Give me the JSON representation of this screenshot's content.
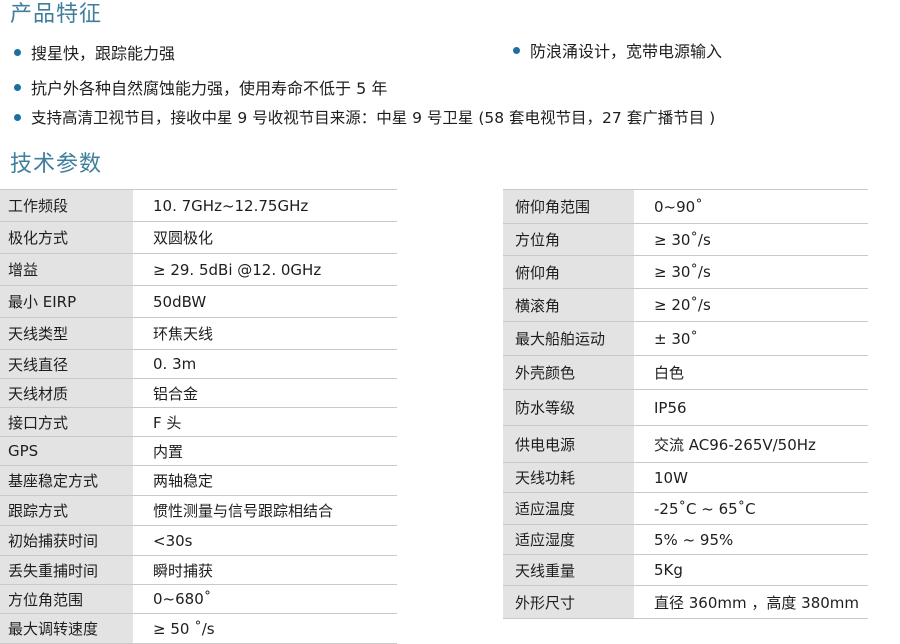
{
  "features_title": "产品特征",
  "specs_title": "技术参数",
  "features": [
    "搜星快，跟踪能力强",
    "防浪涌设计，宽带电源输入",
    "抗户外各种自然腐蚀能力强，使用寿命不低于 5 年",
    "支持高清卫视节目，接收中星 9 号收视节目来源：中星 9 号卫星 (58 套电视节目，27 套广播节目 )"
  ],
  "left_table": [
    {
      "label": "工作频段",
      "value": "10. 7GHz~12.75GHz"
    },
    {
      "label": "极化方式",
      "value": "双圆极化"
    },
    {
      "label": "增益",
      "value": "≥ 29. 5dBi  @12. 0GHz"
    },
    {
      "label": "最小 EIRP",
      "value": "50dBW"
    },
    {
      "label": "天线类型",
      "value": "环焦天线"
    },
    {
      "label": "天线直径",
      "value": "0. 3m"
    },
    {
      "label": "天线材质",
      "value": "铝合金"
    },
    {
      "label": "接口方式",
      "value": "F 头"
    },
    {
      "label": "GPS",
      "value": "内置"
    },
    {
      "label": "基座稳定方式",
      "value": "两轴稳定"
    },
    {
      "label": "跟踪方式",
      "value": "惯性测量与信号跟踪相结合"
    },
    {
      "label": "初始捕获时间",
      "value": "<30s"
    },
    {
      "label": "丢失重捕时间",
      "value": "瞬时捕获"
    },
    {
      "label": "方位角范围",
      "value": "0~680˚"
    },
    {
      "label": "最大调转速度",
      "value": "≥ 50 ˚/s"
    }
  ],
  "right_table": [
    {
      "label": "俯仰角范围",
      "value": "0~90˚"
    },
    {
      "label": "方位角",
      "value": "≥ 30˚/s"
    },
    {
      "label": "俯仰角",
      "value": "≥ 30˚/s"
    },
    {
      "label": "横滚角",
      "value": "≥ 20˚/s"
    },
    {
      "label": "最大船舶运动",
      "value": "± 30˚"
    },
    {
      "label": "外壳颜色",
      "value": "白色"
    },
    {
      "label": "防水等级",
      "value": "IP56"
    },
    {
      "label": "供电电源",
      "value": "交流 AC96-265V/50Hz"
    },
    {
      "label": "天线功耗",
      "value": "10W"
    },
    {
      "label": "适应温度",
      "value": "-25˚C ~ 65˚C"
    },
    {
      "label": "适应湿度",
      "value": "5% ~ 95%"
    },
    {
      "label": "天线重量",
      "value": "5Kg"
    },
    {
      "label": "外形尺寸",
      "value": "直径 360mm ，高度 380mm"
    }
  ]
}
